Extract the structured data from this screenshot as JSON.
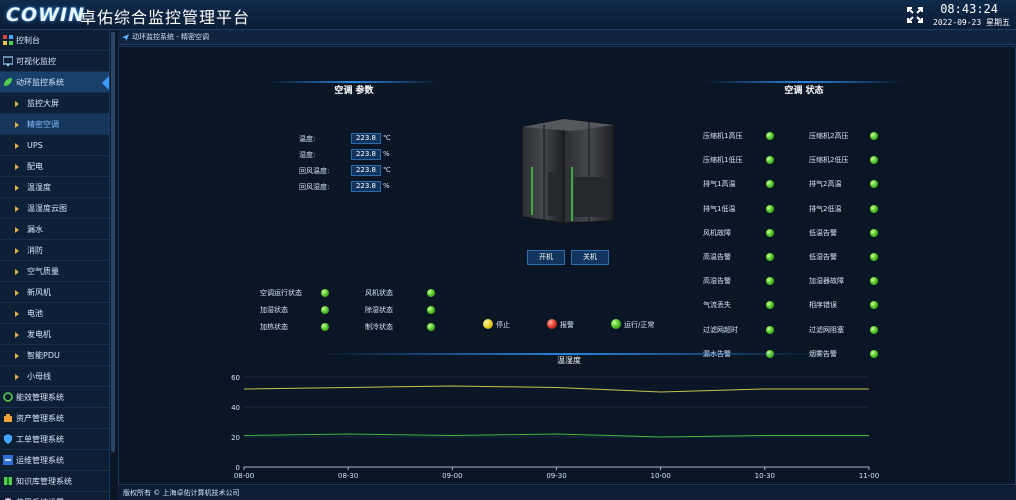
{
  "header": {
    "logo_text": "COWIN",
    "title": "卓佑综合监控管理平台",
    "time": "08:43:24",
    "date": "2022-09-23 星期五"
  },
  "sidebar": {
    "items": [
      {
        "label": "控制台",
        "kind": "top",
        "icon": "dashboard-icon"
      },
      {
        "label": "可视化监控",
        "kind": "top",
        "icon": "monitor-icon"
      },
      {
        "label": "动环监控系统",
        "kind": "top-active",
        "icon": "leaf-icon"
      },
      {
        "label": "监控大屏",
        "kind": "sub"
      },
      {
        "label": "精密空调",
        "kind": "sub-active"
      },
      {
        "label": "UPS",
        "kind": "sub"
      },
      {
        "label": "配电",
        "kind": "sub"
      },
      {
        "label": "温湿度",
        "kind": "sub"
      },
      {
        "label": "温湿度云图",
        "kind": "sub"
      },
      {
        "label": "漏水",
        "kind": "sub"
      },
      {
        "label": "消防",
        "kind": "sub"
      },
      {
        "label": "空气质量",
        "kind": "sub"
      },
      {
        "label": "新风机",
        "kind": "sub"
      },
      {
        "label": "电池",
        "kind": "sub"
      },
      {
        "label": "发电机",
        "kind": "sub"
      },
      {
        "label": "智能PDU",
        "kind": "sub"
      },
      {
        "label": "小母线",
        "kind": "sub"
      },
      {
        "label": "能效管理系统",
        "kind": "top",
        "icon": "recycle-icon"
      },
      {
        "label": "资产管理系统",
        "kind": "top",
        "icon": "asset-icon"
      },
      {
        "label": "工单管理系统",
        "kind": "top",
        "icon": "shield-icon"
      },
      {
        "label": "运维管理系统",
        "kind": "top",
        "icon": "operation-icon"
      },
      {
        "label": "知识库管理系统",
        "kind": "top",
        "icon": "book-icon"
      },
      {
        "label": "使用系统设置",
        "kind": "top",
        "icon": "gear-icon"
      }
    ]
  },
  "breadcrumb": "动环监控系统 - 精密空调",
  "params": {
    "title": "空调 参数",
    "rows": [
      {
        "label": "温度:",
        "value": "223.8",
        "unit": "℃"
      },
      {
        "label": "湿度:",
        "value": "223.8",
        "unit": "%"
      },
      {
        "label": "回风温度:",
        "value": "223.8",
        "unit": "℃"
      },
      {
        "label": "回风湿度:",
        "value": "223.8",
        "unit": "%"
      }
    ]
  },
  "buttons": {
    "on": "开机",
    "off": "关机"
  },
  "run_status": [
    {
      "label": "空调运行状态",
      "color": "#58c92a"
    },
    {
      "label": "风机状态",
      "color": "#58c92a"
    },
    {
      "label": "加湿状态",
      "color": "#58c92a"
    },
    {
      "label": "除湿状态",
      "color": "#58c92a"
    },
    {
      "label": "加热状态",
      "color": "#58c92a"
    },
    {
      "label": "制冷状态",
      "color": "#58c92a"
    }
  ],
  "legend": [
    {
      "label": "停止",
      "color": "yellow"
    },
    {
      "label": "报警",
      "color": "red"
    },
    {
      "label": "运行/正常",
      "color": "green"
    }
  ],
  "status": {
    "title": "空调 状态",
    "left": [
      "压缩机1高压",
      "压缩机1低压",
      "排气1高温",
      "排气1低温",
      "风机故障",
      "高温告警",
      "高湿告警",
      "气流丢失",
      "过滤网超时",
      "漏水告警"
    ],
    "right": [
      "压缩机2高压",
      "压缩机2低压",
      "排气2高温",
      "排气2低温",
      "低温告警",
      "低湿告警",
      "加湿器故障",
      "相序错误",
      "过滤网阻塞",
      "烟雾告警"
    ]
  },
  "chart_data": {
    "type": "line",
    "title": "温湿度",
    "x": [
      "08-00",
      "08-30",
      "09-00",
      "09-30",
      "10-00",
      "10-30",
      "11-00"
    ],
    "ylim": [
      0,
      60
    ],
    "yticks": [
      0,
      20,
      40,
      60
    ],
    "series": [
      {
        "color": "#c8c24a",
        "values": [
          52,
          53,
          54,
          53,
          50,
          52,
          52
        ]
      },
      {
        "color": "#3fb83a",
        "values": [
          21,
          22,
          21,
          22,
          20,
          21,
          21
        ]
      }
    ]
  },
  "footer": "版权所有 © 上海卓佑计算机技术公司"
}
